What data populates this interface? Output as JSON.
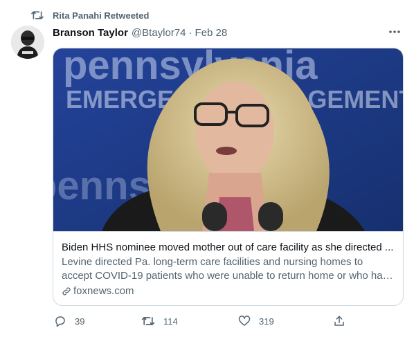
{
  "retweet_banner": {
    "text": "Rita Panahi Retweeted"
  },
  "tweet": {
    "author_name": "Branson Taylor",
    "handle": "@Btaylor74",
    "separator": "·",
    "date": "Feb 28"
  },
  "card": {
    "title": "Biden HHS nominee moved mother out of care facility as she directed ...",
    "description": "Levine directed Pa. long-term care facilities and nursing homes to accept COVID-19 patients who were unable to return home or who had lived ...",
    "domain": "foxnews.com",
    "image_text_top": "pennsylvania",
    "image_text_mid": "EMERGENCY MANAGEMENT AG",
    "image_text_bottom": "pennsylvania"
  },
  "actions": {
    "reply_count": "39",
    "retweet_count": "114",
    "like_count": "319"
  },
  "colors": {
    "secondary_text": "#536471",
    "border": "#cfd9de",
    "image_backdrop": "#1f3b8c"
  },
  "icons": [
    "retweet-icon",
    "more-icon",
    "link-icon",
    "reply-icon",
    "like-icon",
    "share-icon"
  ]
}
